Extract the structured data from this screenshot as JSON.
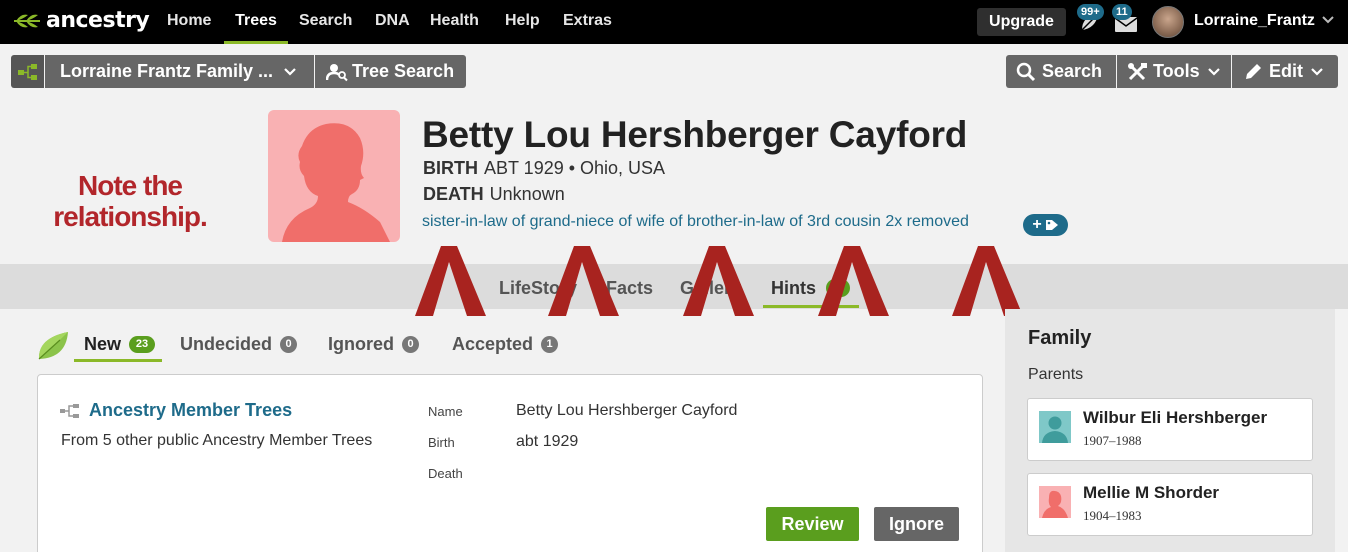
{
  "brand": {
    "logo_text": "ancestry",
    "accent": "#8bb928",
    "link_color": "#1e6b8a"
  },
  "nav": {
    "items": [
      {
        "label": "Home"
      },
      {
        "label": "Trees",
        "active": true
      },
      {
        "label": "Search"
      },
      {
        "label": "DNA"
      },
      {
        "label": "Health"
      },
      {
        "label": "Help"
      },
      {
        "label": "Extras"
      }
    ],
    "upgrade_label": "Upgrade",
    "hints_badge": "99+",
    "messages_badge": "11",
    "username": "Lorraine_Frantz"
  },
  "toolbar": {
    "tree_name": "Lorraine Frantz Family ...",
    "tree_search_label": "Tree Search",
    "search_label": "Search",
    "tools_label": "Tools",
    "edit_label": "Edit"
  },
  "annotation": {
    "line1": "Note the",
    "line2": "relationship."
  },
  "person": {
    "name": "Betty Lou Hershberger Cayford",
    "birth_label": "BIRTH",
    "birth_value": "ABT 1929 • Ohio, USA",
    "death_label": "DEATH",
    "death_value": "Unknown",
    "relationship": "sister-in-law of grand-niece of wife of brother-in-law of 3rd cousin 2x removed",
    "tag_plus": "+"
  },
  "profile_tabs": [
    {
      "label": "LifeStory"
    },
    {
      "label": "Facts"
    },
    {
      "label": "Gallery"
    },
    {
      "label": "Hints",
      "active": true
    }
  ],
  "hint_tabs": [
    {
      "label": "New",
      "count": "23",
      "active": true
    },
    {
      "label": "Undecided",
      "count": "0"
    },
    {
      "label": "Ignored",
      "count": "0"
    },
    {
      "label": "Accepted",
      "count": "1"
    }
  ],
  "hint": {
    "source_title": "Ancestry Member Trees",
    "source_subtitle": "From 5 other public Ancestry Member Trees",
    "fields": [
      {
        "label": "Name",
        "value": "Betty Lou Hershberger Cayford"
      },
      {
        "label": "Birth",
        "value": "abt 1929"
      },
      {
        "label": "Death",
        "value": ""
      }
    ],
    "review_label": "Review",
    "ignore_label": "Ignore"
  },
  "family": {
    "title": "Family",
    "parents_label": "Parents",
    "parents": [
      {
        "name": "Wilbur Eli Hershberger",
        "dates": "1907–1988",
        "gender": "male",
        "color": "#7fc8c8"
      },
      {
        "name": "Mellie M Shorder",
        "dates": "1904–1983",
        "gender": "female",
        "color": "#f39a9a"
      }
    ]
  }
}
